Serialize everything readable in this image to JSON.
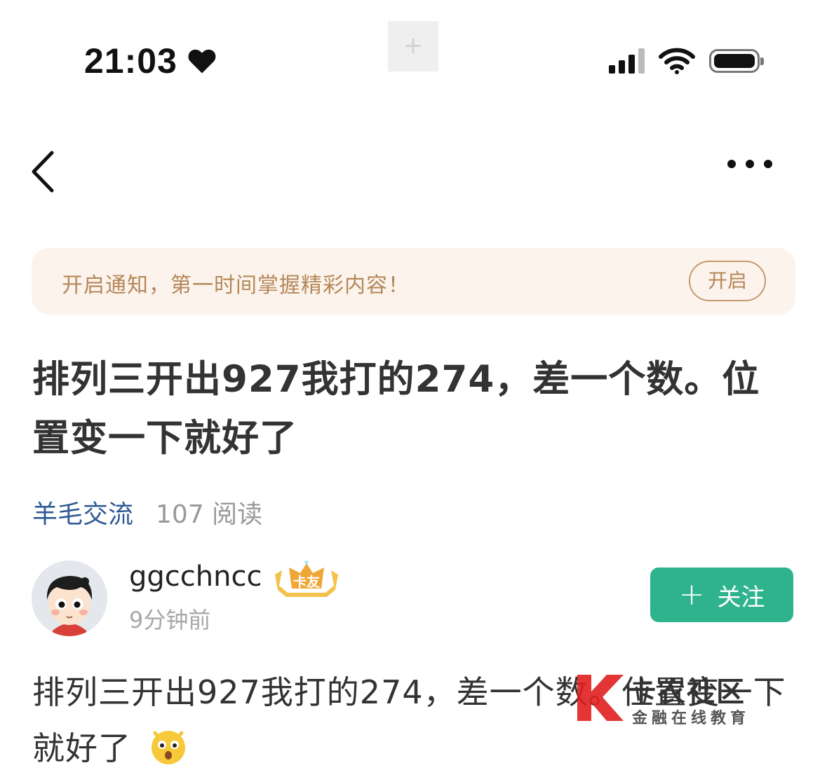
{
  "status_bar": {
    "time": "21:03",
    "heart_icon": "heart-icon",
    "signal_icon": "cellular-signal-icon",
    "wifi_icon": "wifi-icon",
    "battery_icon": "battery-icon",
    "camera_placeholder": "+"
  },
  "nav": {
    "back_icon": "chevron-left-icon",
    "more_icon": "more-dots-icon"
  },
  "notice": {
    "text": "开启通知，第一时间掌握精彩内容！",
    "button_label": "开启"
  },
  "post": {
    "title": "排列三开出927我打的274，差一个数。位置变一下就好了",
    "category": "羊毛交流",
    "reads": "107 阅读",
    "body": "排列三开出927我打的274，差一个数。位置变一下就好了"
  },
  "author": {
    "name": "ggcchncc",
    "badge": "卡友",
    "time": "9分钟前",
    "follow_label": "关注"
  },
  "watermark": {
    "name": "卡农社区",
    "subtitle": "金融在线教育"
  },
  "colors": {
    "accent_green": "#2eb38d",
    "notice_bg": "#fcf4ec",
    "notice_text": "#b5875a",
    "category_blue": "#2f5b95"
  }
}
